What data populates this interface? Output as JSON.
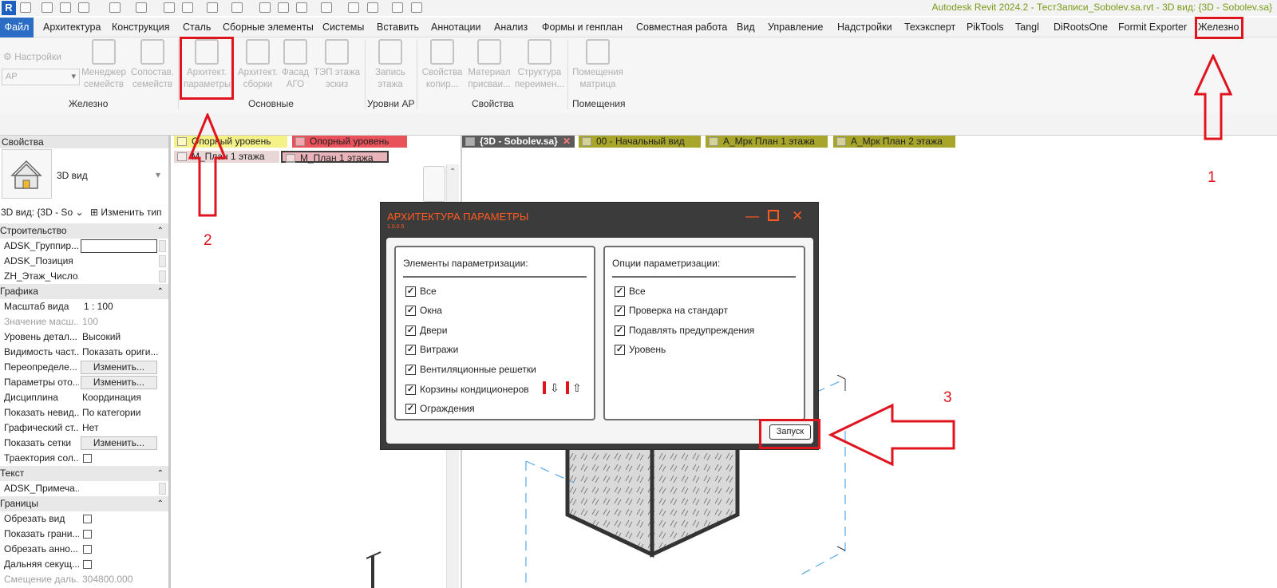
{
  "app": {
    "title": "Autodesk Revit 2024.2 - ТестЗаписи_Sobolev.sa.rvt - 3D вид: {3D - Sobolev.sa}",
    "logo_letter": "R"
  },
  "menu": {
    "file": "Файл",
    "items": [
      "Архитектура",
      "Конструкция",
      "Сталь",
      "Сборные элементы",
      "Системы",
      "Вставить",
      "Аннотации",
      "Анализ",
      "Формы и генплан",
      "Совместная работа",
      "Вид",
      "Управление",
      "Надстройки",
      "Техэксперт",
      "PikTools",
      "Tangl",
      "DiRootsOne",
      "Formit Exporter",
      "Железно"
    ]
  },
  "ribbon": {
    "settings_label": "Настройки",
    "discipline_value": "АР",
    "buttons": [
      "Менеджер семейств",
      "Сопостав. семейств",
      "Архитект. параметры",
      "Архитект. сборки",
      "Фасад АГО",
      "ТЭП этажа эскиз",
      "Запись этажа",
      "Свойства копир...",
      "Материал присваи...",
      "Структура переимен...",
      "Помещения матрица"
    ],
    "groups": [
      "Железно",
      "Основные",
      "Уровни АР",
      "Свойства",
      "Помещения"
    ]
  },
  "tabs_left": [
    "Опорный уровень",
    "Опорный уровень",
    "М_План 1 этажа",
    "М_План 1 этажа"
  ],
  "tabs_right": [
    "{3D - Sobolev.sa}",
    "00 - Начальный вид",
    "А_Мрк План 1 этажа",
    "А_Мрк План 2 этажа"
  ],
  "properties": {
    "header": "Свойства",
    "type_name": "3D вид",
    "selector": "3D вид: {3D - So",
    "edit_type": "Изменить тип",
    "sections": {
      "construction": "Строительство",
      "graphics": "Графика",
      "text": "Текст",
      "bounds": "Границы"
    },
    "rows": {
      "adsk_group": "ADSK_Группир...",
      "adsk_pos": "ADSK_Позиция",
      "zh_floor": "ZH_Этаж_Число...",
      "scale_k": "Масштаб вида",
      "scale_v": "1 : 100",
      "scale_val_k": "Значение масш...",
      "scale_val_v": "100",
      "detail_k": "Уровень детал...",
      "detail_v": "Высокий",
      "parts_k": "Видимость част...",
      "parts_v": "Показать ориги...",
      "override_k": "Переопределе...",
      "params_k": "Параметры ото...",
      "discipline_k": "Дисциплина",
      "discipline_v": "Координация",
      "hidden_k": "Показать невид...",
      "hidden_v": "По категории",
      "graphstyle_k": "Графический ст...",
      "graphstyle_v": "Нет",
      "grids_k": "Показать сетки",
      "sun_k": "Траектория сол...",
      "note_k": "ADSK_Примеча...",
      "crop_k": "Обрезать вид",
      "showcrop_k": "Показать грани...",
      "annocrop_k": "Обрезать анно...",
      "farclip_k": "Дальняя секущ...",
      "offset_k": "Смещение даль...",
      "offset_v": "304800.000",
      "edit_btn": "Изменить..."
    }
  },
  "dialog": {
    "title": "АРХИТЕКТУРА ПАРАМЕТРЫ",
    "version": "1.0.0.5",
    "left_title": "Элементы параметризации:",
    "left_items": [
      "Все",
      "Окна",
      "Двери",
      "Витражи",
      "Вентиляционные решетки",
      "Корзины кондиционеров",
      "Ограждения"
    ],
    "right_title": "Опции параметризации:",
    "right_items": [
      "Все",
      "Проверка на стандарт",
      "Подавлять предупреждения",
      "Уровень"
    ],
    "run_label": "Запуск",
    "check_mark": "✓"
  },
  "annotations": {
    "n1": "1",
    "n2": "2",
    "n3": "3"
  },
  "colors": {
    "accent_blue": "#2b6cc4",
    "dialog_orange": "#ff5a1f",
    "annotation_red": "#e0141e",
    "title_green": "#7a9a1a"
  }
}
